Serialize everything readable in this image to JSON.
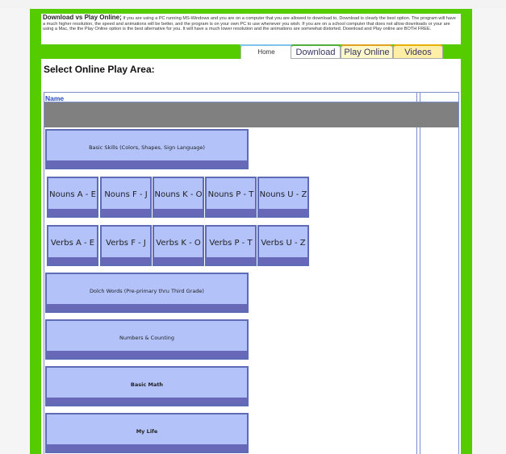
{
  "intro": {
    "heading": "Download vs Play Online;",
    "text": "If you are using a PC running MS-Windows and you are on a computer that you are allowed to download to, Download is clearly the best option.  The program will have a much higher resolution, the speed and animations will be better, and the program is on your own PC to use whenever you wish.  If you are on a school computer that does not allow downloads or your are using a Mac, the the Play Online option is the best alternative for you.  It will have a much lower resolution and the animations are somewhat distorted.  Download and Play online are BOTH FREE."
  },
  "tabs": {
    "home": "Home",
    "download": "Download",
    "play_online": "Play Online",
    "videos": "Videos"
  },
  "page_title": "Select Online Play Area:",
  "table": {
    "header": "Name"
  },
  "buttons": {
    "basic_skills": "Basic Skills (Colors, Shapes, Sign Language)",
    "nouns": [
      "Nouns A - E",
      "Nouns F - J",
      "Nouns K - O",
      "Nouns P - T",
      "Nouns U - Z"
    ],
    "verbs": [
      "Verbs A - E",
      "Verbs F - J",
      "Verbs K - O",
      "Verbs P - T",
      "Verbs U - Z"
    ],
    "dolch": "Dolch Words (Pre-primary thru Third Grade)",
    "numbers": "Numbers & Counting",
    "basic_math": "Basic Math",
    "my_life": "My Life"
  }
}
